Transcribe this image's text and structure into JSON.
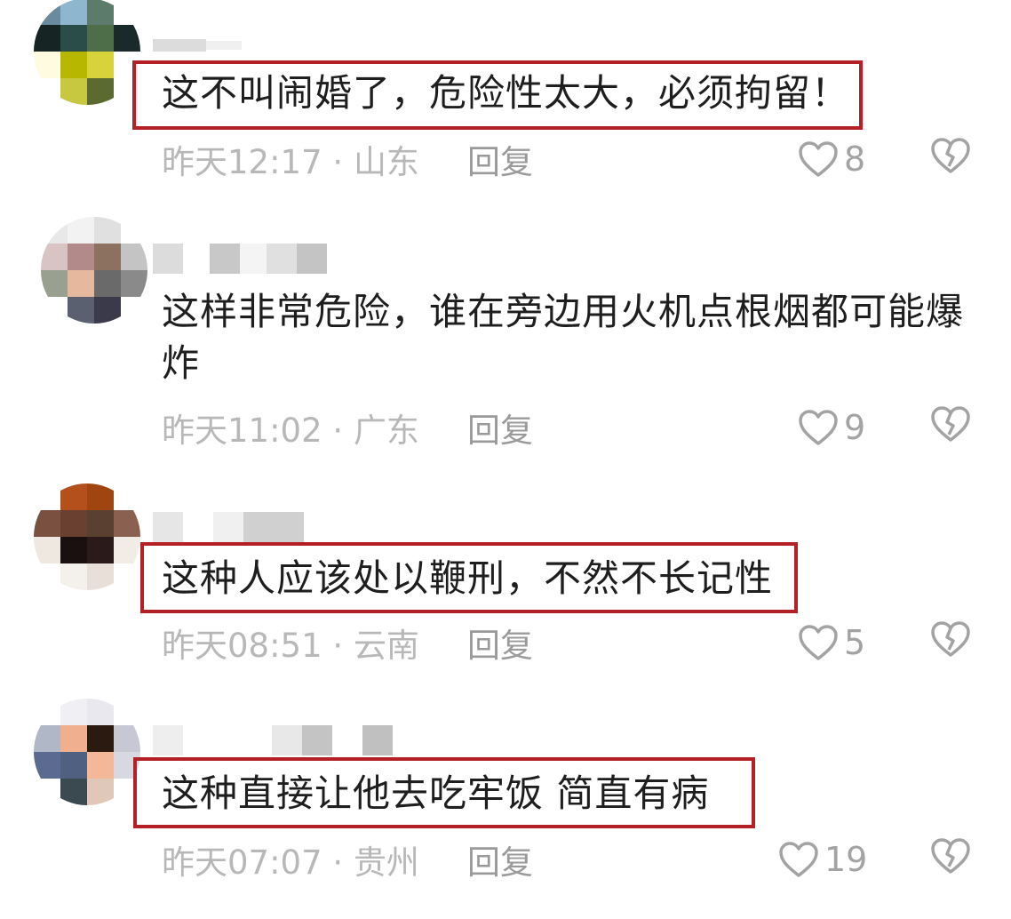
{
  "comments": [
    {
      "text": "这不叫闹婚了，危险性太大，必须拘留！",
      "time": "昨天12:17",
      "location": "山东",
      "reply_label": "回复",
      "likes": "8",
      "highlighted": true
    },
    {
      "text": "这样非常危险，谁在旁边用火机点根烟都可能爆炸",
      "time": "昨天11:02",
      "location": "广东",
      "reply_label": "回复",
      "likes": "9",
      "highlighted": false
    },
    {
      "text": "这种人应该处以鞭刑，不然不长记性",
      "time": "昨天08:51",
      "location": "云南",
      "reply_label": "回复",
      "likes": "5",
      "highlighted": true
    },
    {
      "text": "这种直接让他去吃牢饭 简直有病",
      "time": "昨天07:07",
      "location": "贵州",
      "reply_label": "回复",
      "likes": "19",
      "highlighted": true
    }
  ],
  "separator": "·",
  "icons": {
    "like": "heart-outline-icon",
    "dislike": "broken-heart-icon"
  },
  "colors": {
    "highlight_border": "#b32026",
    "meta_text": "#b8b8b8",
    "body_text": "#1e1e1e"
  }
}
